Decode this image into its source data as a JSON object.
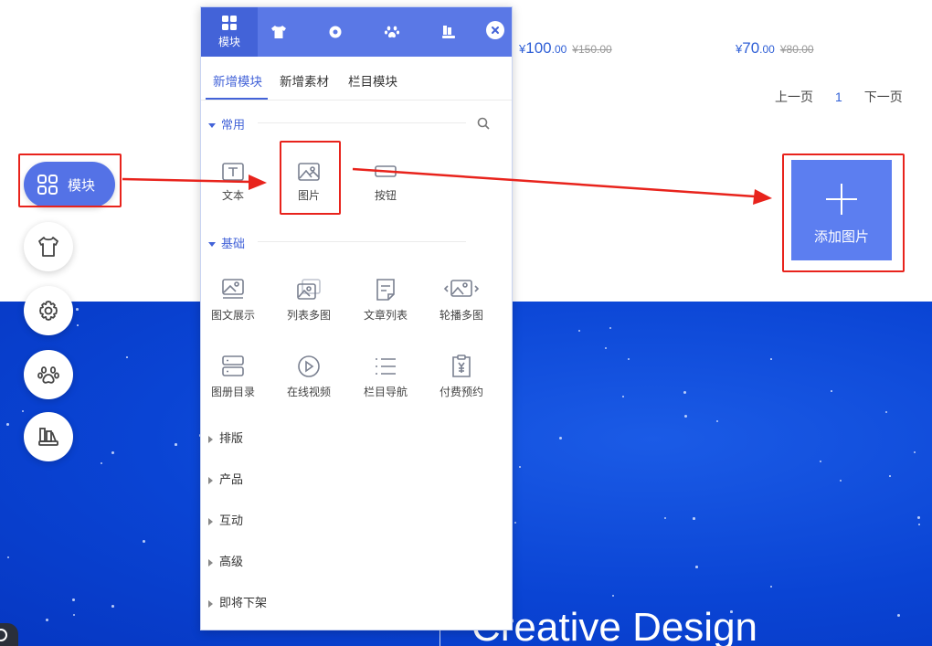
{
  "products": [
    {
      "currency": "¥",
      "int": "100",
      "dec": ".00",
      "old": "¥150.00"
    },
    {
      "currency": "¥",
      "int": "70",
      "dec": ".00",
      "old": "¥80.00"
    }
  ],
  "pager": {
    "prev": "上一页",
    "current": "1",
    "next": "下一页"
  },
  "sidebar": {
    "module_label": "模块",
    "buttons": [
      "shirt-icon",
      "gear-icon",
      "paw-icon",
      "books-icon"
    ]
  },
  "add_image": {
    "label": "添加图片"
  },
  "hero": {
    "title": "Creative Design"
  },
  "panel": {
    "top_tabs": [
      {
        "icon": "grid-icon",
        "label": "模块",
        "active": true
      },
      {
        "icon": "shirt-icon",
        "label": ""
      },
      {
        "icon": "gear-icon",
        "label": ""
      },
      {
        "icon": "paw-icon",
        "label": ""
      },
      {
        "icon": "books-icon",
        "label": ""
      }
    ],
    "sub_tabs": [
      "新增模块",
      "新增素材",
      "栏目模块"
    ],
    "sections": {
      "common": {
        "title": "常用",
        "items": [
          "文本",
          "图片",
          "按钮"
        ]
      },
      "basic": {
        "title": "基础",
        "items": [
          "图文展示",
          "列表多图",
          "文章列表",
          "轮播多图",
          "图册目录",
          "在线视频",
          "栏目导航",
          "付费预约"
        ]
      }
    },
    "collapsed": [
      "排版",
      "产品",
      "互动",
      "高级",
      "即将下架"
    ]
  },
  "colors": {
    "accent": "#5a78e6",
    "accent_dark": "#4363d8",
    "annotation": "#e8231c",
    "hero": "#0a44d4"
  }
}
